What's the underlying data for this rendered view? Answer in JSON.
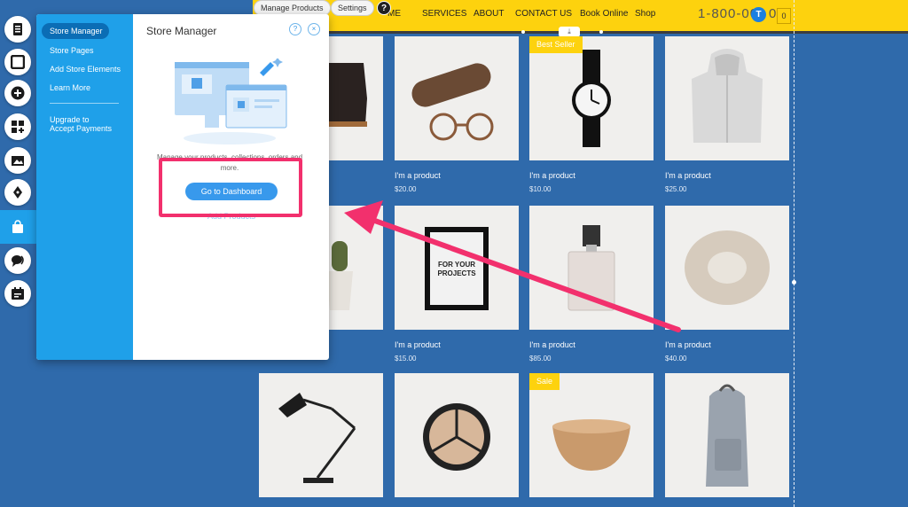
{
  "toolbar": {
    "manage_products": "Manage Products",
    "settings": "Settings",
    "help": "?"
  },
  "site_nav": {
    "items": [
      "ME",
      "SERVICES",
      "ABOUT",
      "CONTACT US",
      "Book Online",
      "Shop"
    ],
    "phone": "1-800-00",
    "phone_tail": "0",
    "cart_badge": "T",
    "cart_count": "0"
  },
  "left_bar": {
    "icons": [
      "pages-icon",
      "background-icon",
      "add-icon",
      "add-apps-icon",
      "media-icon",
      "blog-pen-icon",
      "store-bag-icon",
      "chat-icon",
      "bookings-calendar-icon"
    ]
  },
  "panel": {
    "title": "Store Manager",
    "help": "?",
    "close": "×",
    "side_items": [
      "Store Manager",
      "Store Pages",
      "Add Store Elements",
      "Learn More"
    ],
    "upgrade_line1": "Upgrade to",
    "upgrade_line2": "Accept Payments",
    "description": "Manage your products, collections, orders and more.",
    "dashboard_button": "Go to Dashboard",
    "add_products": "Add Products"
  },
  "products": {
    "ribbon_best_seller": "Best Seller",
    "ribbon_sale": "Sale",
    "items": [
      {
        "name": "I'm a product",
        "price": "$20.00"
      },
      {
        "name": "I'm a product",
        "price": "$10.00"
      },
      {
        "name": "I'm a product",
        "price": "$25.00"
      },
      {
        "name": "I'm a product",
        "price": "$15.00"
      },
      {
        "name": "I'm a product",
        "price": "$85.00"
      },
      {
        "name": "I'm a product",
        "price": "$40.00"
      }
    ],
    "frame_text": "FOR YOUR PROJECTS"
  },
  "colors": {
    "header_yellow": "#fdd20e",
    "page_blue": "#2f6aab",
    "panel_blue": "#1fa0e9",
    "highlight_pink": "#f2306d",
    "button_blue": "#3899ec"
  }
}
